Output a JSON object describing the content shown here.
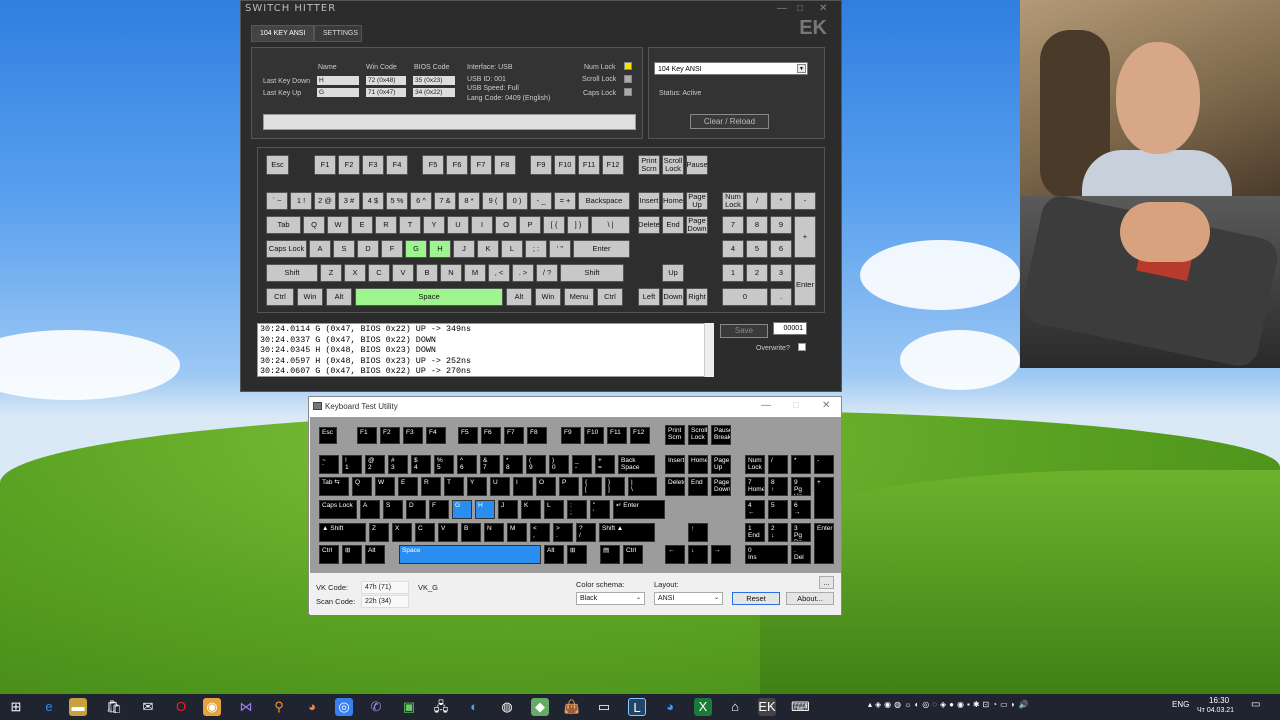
{
  "switch_hitter": {
    "title": "SWITCH HITTER",
    "logo": "EK",
    "window_controls": [
      "—",
      "□",
      "✕"
    ],
    "tabs": [
      "104 KEY ANSI",
      "SETTINGS"
    ],
    "info": {
      "col_name": "Name",
      "col_win": "Win Code",
      "col_bios": "BIOS Code",
      "last_down_label": "Last Key Down",
      "last_up_label": "Last Key Up",
      "down_name": "H",
      "down_win": "72 (0x48)",
      "down_bios": "35 (0x23)",
      "up_name": "G",
      "up_win": "71 (0x47)",
      "up_bios": "34 (0x22)",
      "interface": "Interface:   USB",
      "usb_id": "USB ID:   001",
      "usb_speed": "USB Speed:   Full",
      "lang_code": "Lang Code:   0409 (English)",
      "num_lock": "Num Lock",
      "scroll_lock": "Scroll Lock",
      "caps_lock": "Caps Lock"
    },
    "layout_select": "104 Key ANSI",
    "status": "Status:      Active",
    "clear_button": "Clear / Reload",
    "keys": {
      "esc": "Esc",
      "f1": "F1",
      "f2": "F2",
      "f3": "F3",
      "f4": "F4",
      "f5": "F5",
      "f6": "F6",
      "f7": "F7",
      "f8": "F8",
      "f9": "F9",
      "f10": "F10",
      "f11": "F11",
      "f12": "F12",
      "prtsc": "Print\nScrn",
      "scrlk": "Scroll\nLock",
      "pause": "Pause",
      "r1": [
        "` ~",
        "1 !",
        "2 @",
        "3 #",
        "4 $",
        "5 %",
        "6 ^",
        "7 &",
        "8 *",
        "9 (",
        "0 )",
        "- _",
        "= +",
        "Backspace"
      ],
      "r2": [
        "Tab",
        "Q",
        "W",
        "E",
        "R",
        "T",
        "Y",
        "U",
        "I",
        "O",
        "P",
        "[ {",
        "] }",
        "\\ |"
      ],
      "r3": [
        "Caps Lock",
        "A",
        "S",
        "D",
        "F",
        "G",
        "H",
        "J",
        "K",
        "L",
        "; :",
        "' \"",
        "Enter"
      ],
      "r4": [
        "Shift",
        "Z",
        "X",
        "C",
        "V",
        "B",
        "N",
        "M",
        ", <",
        ". >",
        "/ ?",
        "Shift"
      ],
      "r5": [
        "Ctrl",
        "Win",
        "Alt",
        "Space",
        "Alt",
        "Win",
        "Menu",
        "Ctrl"
      ],
      "nav": [
        "Insert",
        "Home",
        "Page\nUp",
        "Delete",
        "End",
        "Page\nDown",
        "Up",
        "Left",
        "Down",
        "Right"
      ],
      "num": [
        "Num\nLock",
        "/",
        "*",
        "-",
        "7",
        "8",
        "9",
        "+",
        "4",
        "5",
        "6",
        "1",
        "2",
        "3",
        "Enter",
        "0",
        "."
      ]
    },
    "log": [
      "30:24.0114 G (0x47, BIOS 0x22) UP -> 349ns",
      "30:24.0337 G (0x47, BIOS 0x22) DOWN",
      "30:24.0345 H (0x48, BIOS 0x23) DOWN",
      "30:24.0597 H (0x48, BIOS 0x23) UP -> 252ns",
      "30:24.0607 G (0x47, BIOS 0x22) UP -> 270ns"
    ],
    "save_button": "Save",
    "counter": "00001",
    "overwrite": "Overwrite?"
  },
  "ktu": {
    "title": "Keyboard Test Utility",
    "window_controls": [
      "—",
      "□",
      "✕"
    ],
    "keys": {
      "esc": "Esc",
      "f": [
        "F1",
        "F2",
        "F3",
        "F4",
        "F5",
        "F6",
        "F7",
        "F8",
        "F9",
        "F10",
        "F11",
        "F12"
      ],
      "prt": "Print\nScrn",
      "scr": "Scroll\nLock",
      "pause": "Pause\nBreak",
      "r1": [
        "~\n`",
        "!\n1",
        "@\n2",
        "#\n3",
        "$\n4",
        "%\n5",
        "^\n6",
        "&\n7",
        "*\n8",
        "(\n9",
        ")\n0",
        "_\n-",
        "+\n=",
        "Back Space"
      ],
      "r2": [
        "Tab ⇆",
        "Q",
        "W",
        "E",
        "R",
        "T",
        "Y",
        "U",
        "I",
        "O",
        "P",
        "{\n[",
        "}\n]",
        "|\n\\"
      ],
      "r3": [
        "Caps Lock",
        "A",
        "S",
        "D",
        "F",
        "G",
        "H",
        "J",
        "K",
        "L",
        ":\n;",
        "\"\n'",
        "↵  Enter"
      ],
      "r4": [
        "▲     Shift",
        "Z",
        "X",
        "C",
        "V",
        "B",
        "N",
        "M",
        "<\n,",
        ">\n.",
        "?\n/",
        "Shift   ▲"
      ],
      "r5": [
        "Ctrl",
        "⊞",
        "Alt",
        "Space",
        "Alt",
        "⊞",
        "▤",
        "Ctrl"
      ],
      "nav": [
        "Insert",
        "Home",
        "Page\nUp",
        "Delete",
        "End",
        "Page\nDown",
        "↑",
        "←",
        "↓",
        "→"
      ],
      "num": [
        "Num\nLock",
        "/",
        "*",
        "-",
        "7\nHome",
        "8\n↑",
        "9\nPg Up",
        "+",
        "4\n←",
        "5",
        "6\n→",
        "1\nEnd",
        "2\n↓",
        "3\nPg Dn",
        "Enter",
        "0\nIns",
        ".\nDel"
      ]
    },
    "vk_code_label": "VK Code:",
    "vk_code": "47h (71)",
    "vk_name": "VK_G",
    "scan_code_label": "Scan Code:",
    "scan_code": "22h (34)",
    "color_schema_label": "Color schema:",
    "color_schema": "Black",
    "layout_label": "Layout:",
    "layout": "ANSI",
    "reset": "Reset",
    "about": "About...",
    "more": "..."
  },
  "taskbar": {
    "language": "ENG",
    "time": "16:30",
    "date": "Чт 04.03.21"
  },
  "colors": {
    "highlight_green": "#9ef58f",
    "highlight_blue": "#2a8ef0",
    "num_lock_on": "#f5e400"
  }
}
